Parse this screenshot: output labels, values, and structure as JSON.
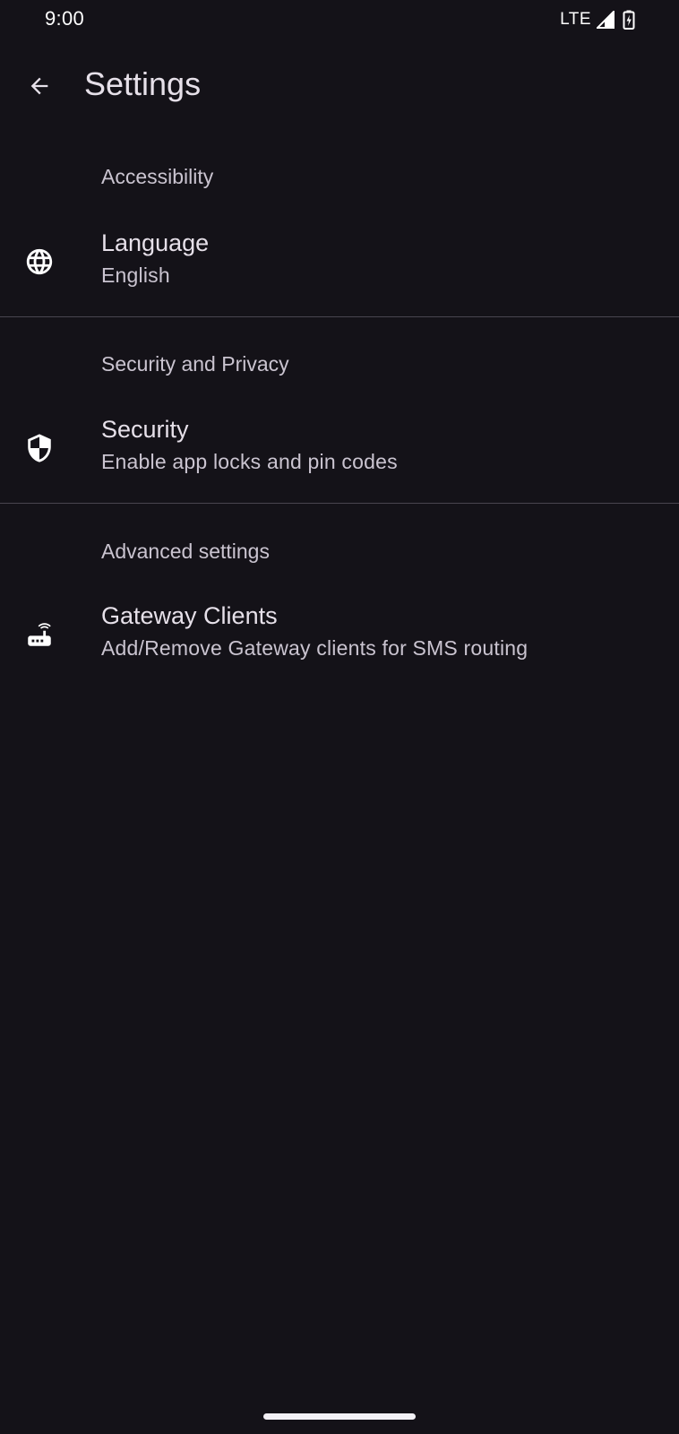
{
  "status_bar": {
    "time": "9:00",
    "network": "LTE",
    "signal_icon": "cellular-signal-icon",
    "battery_icon": "battery-charging-icon"
  },
  "top_bar": {
    "back_icon": "arrow-back-icon",
    "title": "Settings"
  },
  "sections": [
    {
      "header": "Accessibility",
      "items": [
        {
          "icon": "globe-icon",
          "title": "Language",
          "summary": "English"
        }
      ]
    },
    {
      "header": "Security and Privacy",
      "items": [
        {
          "icon": "shield-icon",
          "title": "Security",
          "summary": "Enable app locks and pin codes"
        }
      ]
    },
    {
      "header": "Advanced settings",
      "items": [
        {
          "icon": "router-icon",
          "title": "Gateway Clients",
          "summary": "Add/Remove Gateway clients for SMS routing"
        }
      ]
    }
  ],
  "colors": {
    "background": "#141218",
    "primary_text": "#E6E0E9",
    "secondary_text": "#CAC4D0",
    "divider": "#49454F"
  }
}
